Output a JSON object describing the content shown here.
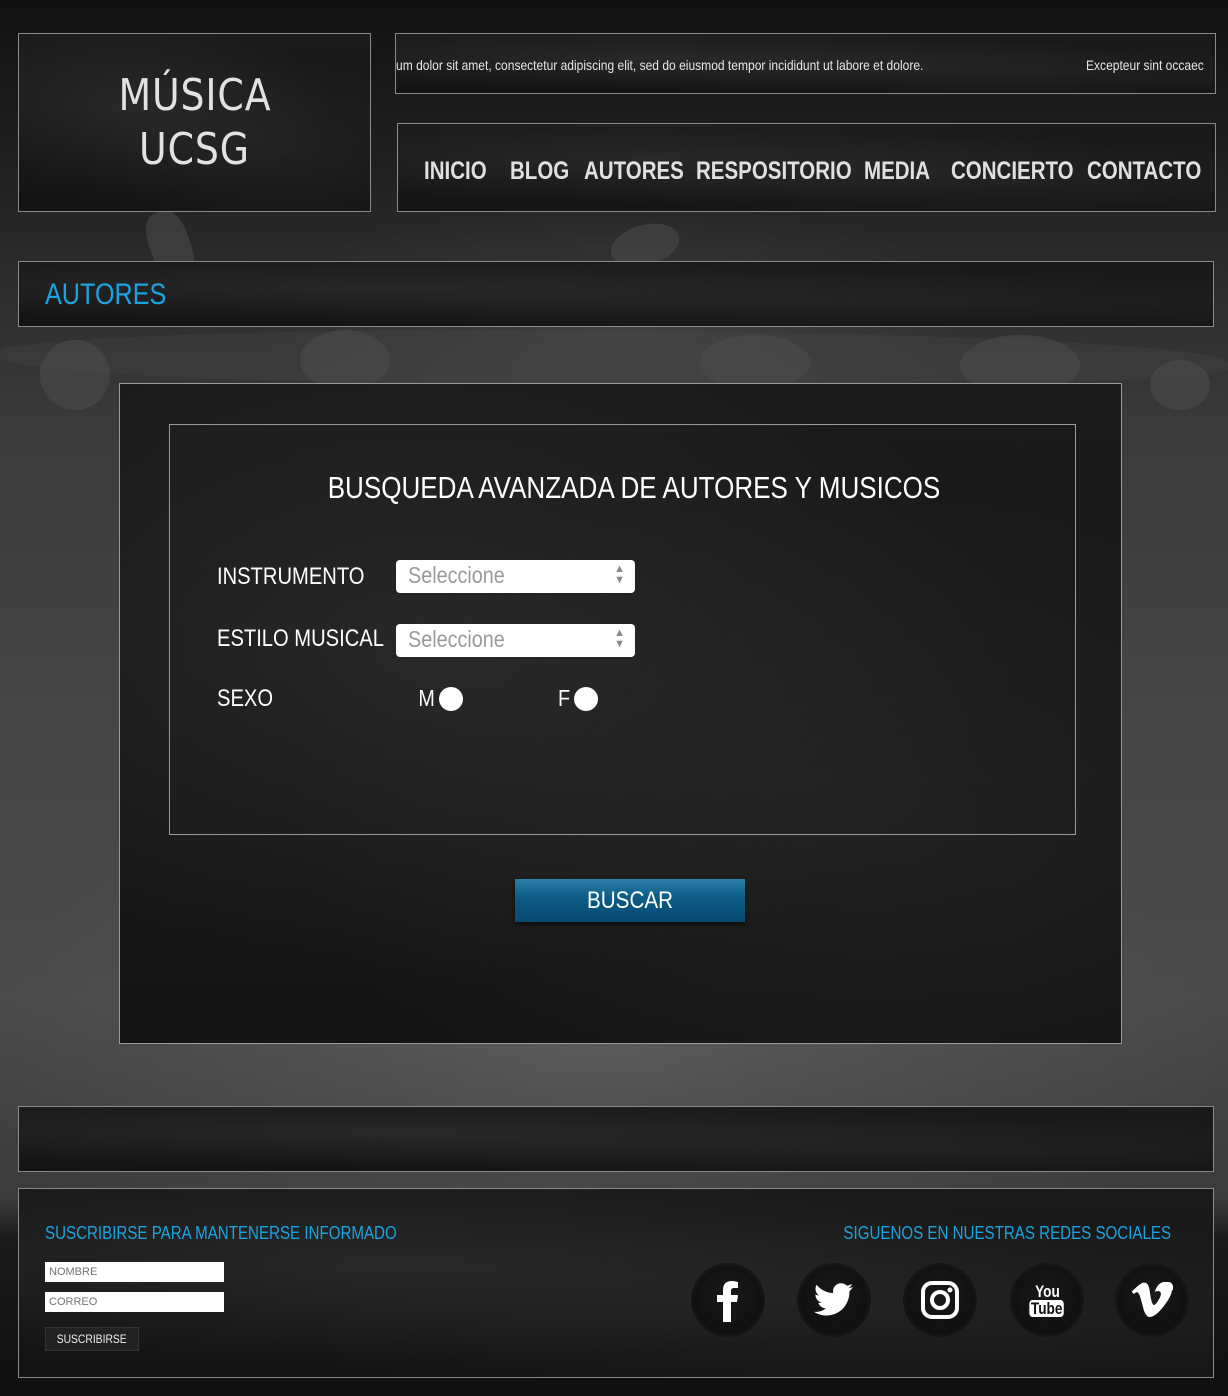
{
  "header": {
    "logo_line1": "MÚSICA",
    "logo_line2": "UCSG",
    "ticker_text1": "um dolor sit amet, consectetur adipiscing elit, sed do eiusmod tempor incididunt ut labore et dolore.",
    "ticker_text2": "Excepteur sint occaec",
    "nav": [
      "INICIO",
      "BLOG",
      "AUTORES",
      "RESPOSITORIO",
      "MEDIA",
      "CONCIERTO",
      "CONTACTO"
    ]
  },
  "page_title": "AUTORES",
  "form": {
    "title": "BUSQUEDA AVANZADA DE AUTORES Y MUSICOS",
    "instrumento_label": "INSTRUMENTO",
    "instrumento_value": "Seleccione",
    "estilo_label": "ESTILO MUSICAL",
    "estilo_value": "Seleccione",
    "sexo_label": "SEXO",
    "sexo_m": "M",
    "sexo_f": "F",
    "search_button": "BUSCAR"
  },
  "footer": {
    "subscribe_title": "SUSCRIBIRSE PARA MANTENERSE INFORMADO",
    "nombre_placeholder": "NOMBRE",
    "correo_placeholder": "CORREO",
    "subscribe_button": "SUSCRIBIRSE",
    "social_title": "SIGUENOS EN NUESTRAS REDES SOCIALES",
    "social_icons": [
      "facebook-icon",
      "twitter-icon",
      "instagram-icon",
      "youtube-icon",
      "vimeo-icon"
    ],
    "youtube_you": "You",
    "youtube_tube": "Tube"
  },
  "colors": {
    "accent": "#1aa3e0",
    "button": "#0b5a86"
  }
}
